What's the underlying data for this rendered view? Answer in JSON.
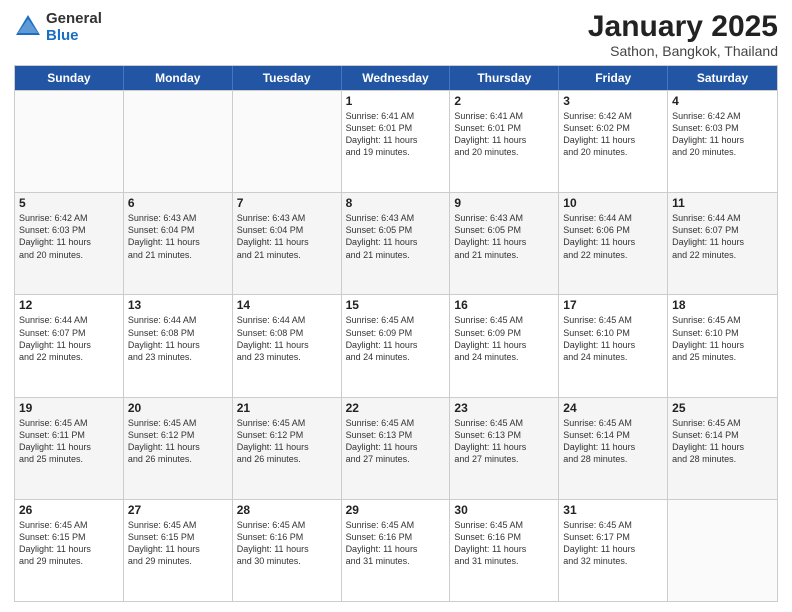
{
  "header": {
    "logo_general": "General",
    "logo_blue": "Blue",
    "month_title": "January 2025",
    "subtitle": "Sathon, Bangkok, Thailand"
  },
  "weekdays": [
    "Sunday",
    "Monday",
    "Tuesday",
    "Wednesday",
    "Thursday",
    "Friday",
    "Saturday"
  ],
  "rows": [
    [
      {
        "day": "",
        "lines": []
      },
      {
        "day": "",
        "lines": []
      },
      {
        "day": "",
        "lines": []
      },
      {
        "day": "1",
        "lines": [
          "Sunrise: 6:41 AM",
          "Sunset: 6:01 PM",
          "Daylight: 11 hours",
          "and 19 minutes."
        ]
      },
      {
        "day": "2",
        "lines": [
          "Sunrise: 6:41 AM",
          "Sunset: 6:01 PM",
          "Daylight: 11 hours",
          "and 20 minutes."
        ]
      },
      {
        "day": "3",
        "lines": [
          "Sunrise: 6:42 AM",
          "Sunset: 6:02 PM",
          "Daylight: 11 hours",
          "and 20 minutes."
        ]
      },
      {
        "day": "4",
        "lines": [
          "Sunrise: 6:42 AM",
          "Sunset: 6:03 PM",
          "Daylight: 11 hours",
          "and 20 minutes."
        ]
      }
    ],
    [
      {
        "day": "5",
        "lines": [
          "Sunrise: 6:42 AM",
          "Sunset: 6:03 PM",
          "Daylight: 11 hours",
          "and 20 minutes."
        ]
      },
      {
        "day": "6",
        "lines": [
          "Sunrise: 6:43 AM",
          "Sunset: 6:04 PM",
          "Daylight: 11 hours",
          "and 21 minutes."
        ]
      },
      {
        "day": "7",
        "lines": [
          "Sunrise: 6:43 AM",
          "Sunset: 6:04 PM",
          "Daylight: 11 hours",
          "and 21 minutes."
        ]
      },
      {
        "day": "8",
        "lines": [
          "Sunrise: 6:43 AM",
          "Sunset: 6:05 PM",
          "Daylight: 11 hours",
          "and 21 minutes."
        ]
      },
      {
        "day": "9",
        "lines": [
          "Sunrise: 6:43 AM",
          "Sunset: 6:05 PM",
          "Daylight: 11 hours",
          "and 21 minutes."
        ]
      },
      {
        "day": "10",
        "lines": [
          "Sunrise: 6:44 AM",
          "Sunset: 6:06 PM",
          "Daylight: 11 hours",
          "and 22 minutes."
        ]
      },
      {
        "day": "11",
        "lines": [
          "Sunrise: 6:44 AM",
          "Sunset: 6:07 PM",
          "Daylight: 11 hours",
          "and 22 minutes."
        ]
      }
    ],
    [
      {
        "day": "12",
        "lines": [
          "Sunrise: 6:44 AM",
          "Sunset: 6:07 PM",
          "Daylight: 11 hours",
          "and 22 minutes."
        ]
      },
      {
        "day": "13",
        "lines": [
          "Sunrise: 6:44 AM",
          "Sunset: 6:08 PM",
          "Daylight: 11 hours",
          "and 23 minutes."
        ]
      },
      {
        "day": "14",
        "lines": [
          "Sunrise: 6:44 AM",
          "Sunset: 6:08 PM",
          "Daylight: 11 hours",
          "and 23 minutes."
        ]
      },
      {
        "day": "15",
        "lines": [
          "Sunrise: 6:45 AM",
          "Sunset: 6:09 PM",
          "Daylight: 11 hours",
          "and 24 minutes."
        ]
      },
      {
        "day": "16",
        "lines": [
          "Sunrise: 6:45 AM",
          "Sunset: 6:09 PM",
          "Daylight: 11 hours",
          "and 24 minutes."
        ]
      },
      {
        "day": "17",
        "lines": [
          "Sunrise: 6:45 AM",
          "Sunset: 6:10 PM",
          "Daylight: 11 hours",
          "and 24 minutes."
        ]
      },
      {
        "day": "18",
        "lines": [
          "Sunrise: 6:45 AM",
          "Sunset: 6:10 PM",
          "Daylight: 11 hours",
          "and 25 minutes."
        ]
      }
    ],
    [
      {
        "day": "19",
        "lines": [
          "Sunrise: 6:45 AM",
          "Sunset: 6:11 PM",
          "Daylight: 11 hours",
          "and 25 minutes."
        ]
      },
      {
        "day": "20",
        "lines": [
          "Sunrise: 6:45 AM",
          "Sunset: 6:12 PM",
          "Daylight: 11 hours",
          "and 26 minutes."
        ]
      },
      {
        "day": "21",
        "lines": [
          "Sunrise: 6:45 AM",
          "Sunset: 6:12 PM",
          "Daylight: 11 hours",
          "and 26 minutes."
        ]
      },
      {
        "day": "22",
        "lines": [
          "Sunrise: 6:45 AM",
          "Sunset: 6:13 PM",
          "Daylight: 11 hours",
          "and 27 minutes."
        ]
      },
      {
        "day": "23",
        "lines": [
          "Sunrise: 6:45 AM",
          "Sunset: 6:13 PM",
          "Daylight: 11 hours",
          "and 27 minutes."
        ]
      },
      {
        "day": "24",
        "lines": [
          "Sunrise: 6:45 AM",
          "Sunset: 6:14 PM",
          "Daylight: 11 hours",
          "and 28 minutes."
        ]
      },
      {
        "day": "25",
        "lines": [
          "Sunrise: 6:45 AM",
          "Sunset: 6:14 PM",
          "Daylight: 11 hours",
          "and 28 minutes."
        ]
      }
    ],
    [
      {
        "day": "26",
        "lines": [
          "Sunrise: 6:45 AM",
          "Sunset: 6:15 PM",
          "Daylight: 11 hours",
          "and 29 minutes."
        ]
      },
      {
        "day": "27",
        "lines": [
          "Sunrise: 6:45 AM",
          "Sunset: 6:15 PM",
          "Daylight: 11 hours",
          "and 29 minutes."
        ]
      },
      {
        "day": "28",
        "lines": [
          "Sunrise: 6:45 AM",
          "Sunset: 6:16 PM",
          "Daylight: 11 hours",
          "and 30 minutes."
        ]
      },
      {
        "day": "29",
        "lines": [
          "Sunrise: 6:45 AM",
          "Sunset: 6:16 PM",
          "Daylight: 11 hours",
          "and 31 minutes."
        ]
      },
      {
        "day": "30",
        "lines": [
          "Sunrise: 6:45 AM",
          "Sunset: 6:16 PM",
          "Daylight: 11 hours",
          "and 31 minutes."
        ]
      },
      {
        "day": "31",
        "lines": [
          "Sunrise: 6:45 AM",
          "Sunset: 6:17 PM",
          "Daylight: 11 hours",
          "and 32 minutes."
        ]
      },
      {
        "day": "",
        "lines": []
      }
    ]
  ]
}
